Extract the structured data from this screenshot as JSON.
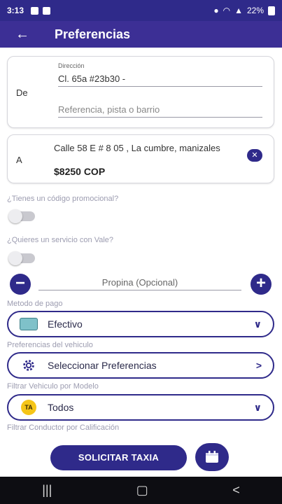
{
  "status_bar": {
    "time": "3:13",
    "battery": "22%",
    "wifi_icon": "wifi-icon",
    "signal_icon": "signal-icon"
  },
  "header": {
    "title": "Preferencias",
    "back_icon": "arrow-left-icon"
  },
  "origin": {
    "side_label": "De",
    "field_caption": "Dirección",
    "address_value": "Cl. 65a #23b30 -",
    "reference_placeholder": "Referencia, pista o barrio"
  },
  "destination": {
    "side_label": "A",
    "address": "Calle 58 E # 8 05 , La cumbre, manizales",
    "price": "$8250 COP",
    "clear_icon": "close-icon"
  },
  "promo": {
    "question": "¿Tienes un código promocional?",
    "enabled": false
  },
  "vale": {
    "question": "¿Quieres un servicio con Vale?",
    "enabled": false
  },
  "tip": {
    "placeholder": "Propina (Opcional)",
    "minus_label": "−",
    "plus_label": "+"
  },
  "payment": {
    "section_label": "Metodo de pago",
    "selected": "Efectivo",
    "icon": "cash-icon"
  },
  "vehicle_prefs": {
    "section_label": "Preferencias del vehiculo",
    "selected": "Seleccionar Preferencias",
    "icon": "gear-icon"
  },
  "vehicle_model": {
    "section_label": "Filtrar Vehiculo por Modelo",
    "selected": "Todos",
    "icon": "taxi-icon",
    "icon_text": "TA"
  },
  "driver_filter": {
    "section_label": "Filtrar Conductor por Calificación"
  },
  "actions": {
    "request_label": "SOLICITAR TAXIA",
    "schedule_icon": "calendar-icon"
  },
  "colors": {
    "primary": "#2f2a8a",
    "header": "#3c2f95",
    "muted": "#9c9cb0"
  }
}
